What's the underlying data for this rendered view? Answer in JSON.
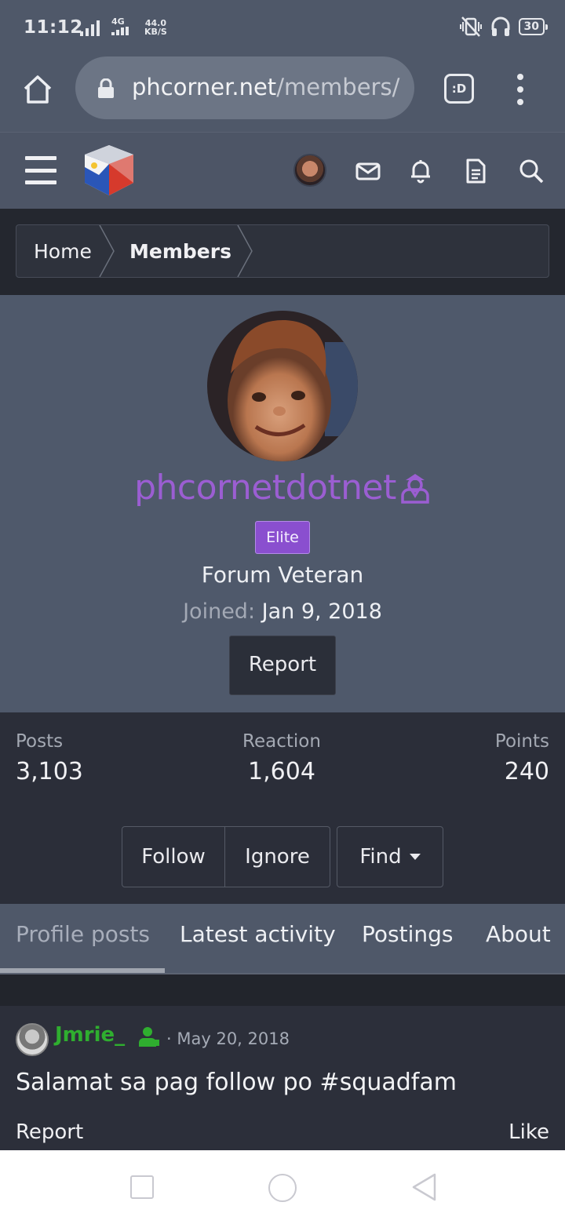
{
  "status_bar": {
    "time": "11:12",
    "network": "4G",
    "speed_value": "44.0",
    "speed_unit": "KB/S",
    "battery": "30"
  },
  "browser": {
    "url_host": "phcorner.net",
    "url_path": "/members/",
    "tab_switcher_label": ":D"
  },
  "breadcrumb": {
    "items": [
      {
        "label": "Home"
      },
      {
        "label": "Members"
      }
    ]
  },
  "profile": {
    "username": "phcornetdotnet",
    "badge": "Elite",
    "user_title": "Forum Veteran",
    "joined_label": "Joined:",
    "joined_date": "Jan 9, 2018",
    "report_label": "Report"
  },
  "stats": {
    "posts_label": "Posts",
    "posts_value": "3,103",
    "reaction_label": "Reaction",
    "reaction_value": "1,604",
    "points_label": "Points",
    "points_value": "240"
  },
  "actions": {
    "follow": "Follow",
    "ignore": "Ignore",
    "find": "Find"
  },
  "tabs": [
    {
      "label": "Profile posts",
      "active": true
    },
    {
      "label": "Latest activity",
      "active": false
    },
    {
      "label": "Postings",
      "active": false
    },
    {
      "label": "About",
      "active": false
    }
  ],
  "post": {
    "author": "Jmrie_",
    "date": "May 20, 2018",
    "date_prefix": "·",
    "body": "Salamat sa pag follow po #squadfam",
    "report_label": "Report",
    "like_label": "Like"
  },
  "colors": {
    "username": "#9b5ed2",
    "badge": "#8a4fcf",
    "post_author": "#2fae2f",
    "header_bg": "#4f5869"
  },
  "icons": {
    "status_right": [
      "vibrate-icon",
      "headphones-icon",
      "battery-icon"
    ],
    "header": [
      "avatar",
      "mail-icon",
      "bell-icon",
      "document-icon",
      "search-icon"
    ]
  }
}
